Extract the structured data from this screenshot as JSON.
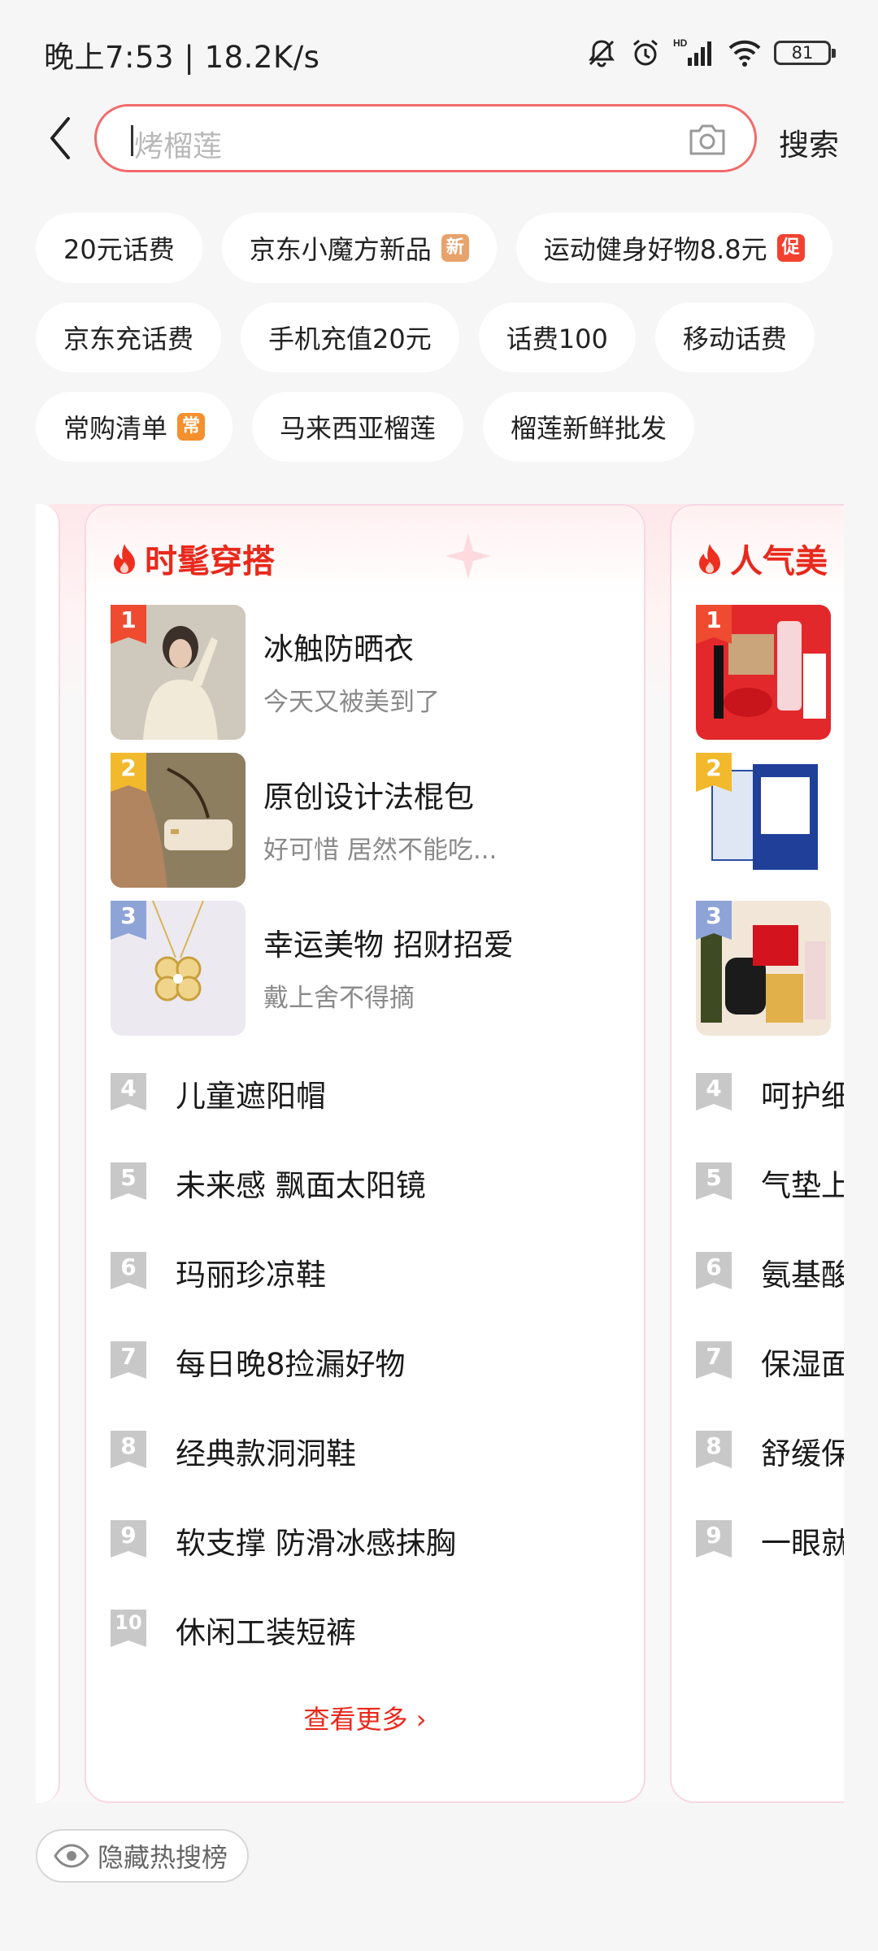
{
  "status_bar": {
    "time": "晚上7:53 | 18.2K/s",
    "battery": "81",
    "signal_label": "HD",
    "icons": [
      "mute-bell-icon",
      "alarm-icon",
      "signal-icon",
      "wifi-icon",
      "battery-icon"
    ]
  },
  "search": {
    "placeholder": "烤榴莲",
    "button_label": "搜索"
  },
  "chips": {
    "rows": [
      [
        {
          "label": "20元话费"
        },
        {
          "label": "京东小魔方新品",
          "tag": "新"
        },
        {
          "label": "运动健身好物8.8元",
          "tag": "促"
        }
      ],
      [
        {
          "label": "京东充话费"
        },
        {
          "label": "手机充值20元"
        },
        {
          "label": "话费100"
        },
        {
          "label": "移动话费"
        }
      ],
      [
        {
          "label": "常购清单",
          "tag": "常"
        },
        {
          "label": "马来西亚榴莲"
        },
        {
          "label": "榴莲新鲜批发"
        }
      ]
    ]
  },
  "boards": [
    {
      "title": "时髦穿搭",
      "top_items": [
        {
          "rank": "1",
          "title": "冰触防晒衣",
          "subtitle": "今天又被美到了"
        },
        {
          "rank": "2",
          "title": "原创设计法棍包",
          "subtitle": "好可惜 居然不能吃..."
        },
        {
          "rank": "3",
          "title": "幸运美物 招财招爱",
          "subtitle": "戴上舍不得摘"
        }
      ],
      "items": [
        {
          "rank": "4",
          "label": "儿童遮阳帽"
        },
        {
          "rank": "5",
          "label": "未来感 飘面太阳镜"
        },
        {
          "rank": "6",
          "label": "玛丽珍凉鞋"
        },
        {
          "rank": "7",
          "label": "每日晚8捡漏好物"
        },
        {
          "rank": "8",
          "label": "经典款洞洞鞋"
        },
        {
          "rank": "9",
          "label": "软支撑 防滑冰感抹胸"
        },
        {
          "rank": "10",
          "label": "休闲工装短裤"
        }
      ],
      "see_more": "查看更多"
    },
    {
      "title": "人气美",
      "top_items": [
        {
          "rank": "1"
        },
        {
          "rank": "2"
        },
        {
          "rank": "3"
        }
      ],
      "items": [
        {
          "rank": "4",
          "label": "呵护细"
        },
        {
          "rank": "5",
          "label": "气垫上"
        },
        {
          "rank": "6",
          "label": "氨基酸"
        },
        {
          "rank": "7",
          "label": "保湿面"
        },
        {
          "rank": "8",
          "label": "舒缓保"
        },
        {
          "rank": "9",
          "label": "一眼就"
        }
      ]
    }
  ],
  "hide_button": {
    "label": "隐藏热搜榜"
  },
  "colors": {
    "accent_red": "#e8291c",
    "search_border": "#f26b6b",
    "rank1": "#ee4b31",
    "rank2": "#f2b92d",
    "rank3": "#8fa4d6",
    "rank_other": "#c8c8c8"
  }
}
